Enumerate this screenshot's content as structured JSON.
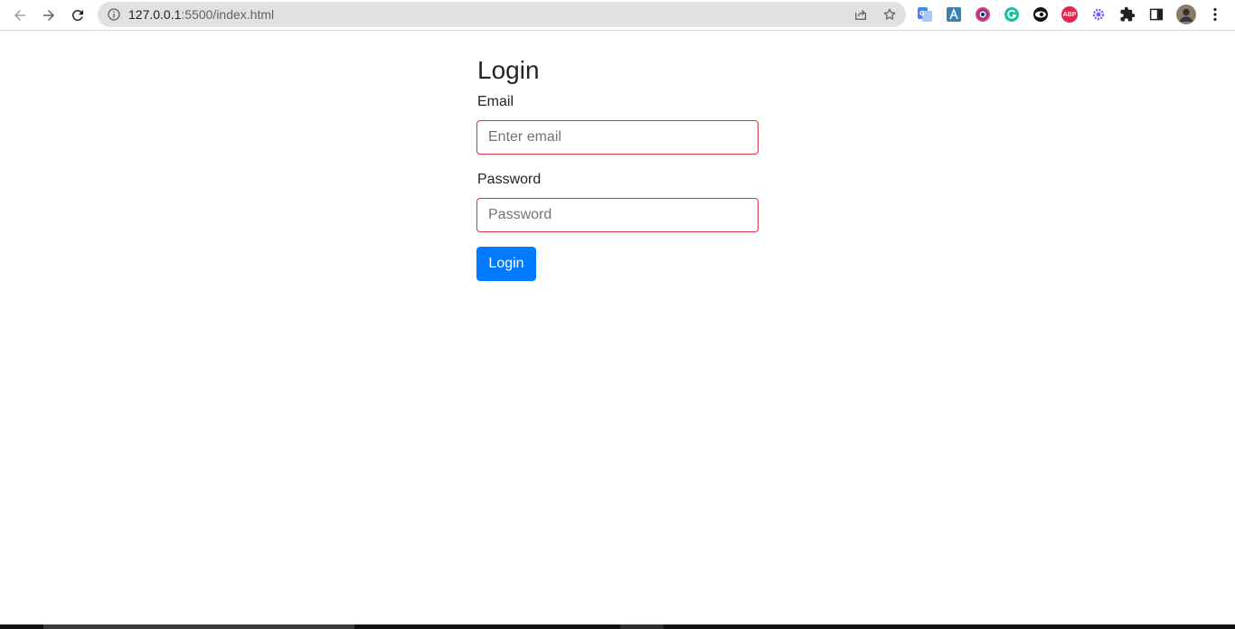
{
  "browser": {
    "url_host": "127.0.0.1",
    "url_rest": ":5500/index.html",
    "icons": {
      "back": "arrow-left-icon",
      "forward": "arrow-right-icon",
      "reload": "reload-icon",
      "site_info": "info-icon",
      "share": "share-icon",
      "bookmark": "star-icon"
    },
    "extensions": [
      {
        "name": "google-translate-extension-icon"
      },
      {
        "name": "accessibility-extension-icon"
      },
      {
        "name": "color-picker-extension-icon"
      },
      {
        "name": "grammarly-extension-icon"
      },
      {
        "name": "eye-extension-icon"
      },
      {
        "name": "adblock-plus-extension-icon",
        "text": "ABP"
      },
      {
        "name": "gear-extension-icon"
      },
      {
        "name": "puzzle-extensions-icon"
      },
      {
        "name": "side-panel-icon"
      },
      {
        "name": "profile-avatar"
      },
      {
        "name": "kebab-menu-icon"
      }
    ]
  },
  "login": {
    "title": "Login",
    "email_label": "Email",
    "email_placeholder": "Enter email",
    "email_value": "",
    "password_label": "Password",
    "password_placeholder": "Password",
    "password_value": "",
    "submit_label": "Login"
  },
  "colors": {
    "primary": "#007bff",
    "invalid_border": "#dc3545",
    "text": "#212529"
  }
}
